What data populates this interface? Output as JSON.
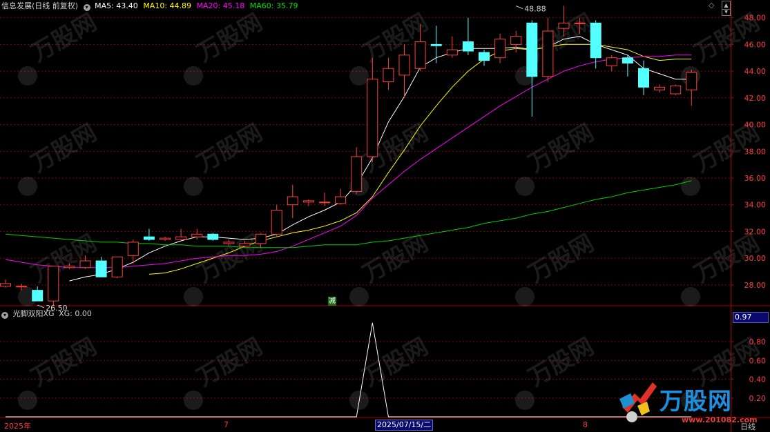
{
  "header": {
    "title": "信息发展(日线 前复权)",
    "ma5_label": "MA5: 43.40",
    "ma10_label": "MA10: 44.89",
    "ma20_label": "MA20: 45.18",
    "ma60_label": "MA60: 35.79"
  },
  "sub": {
    "indicator": "光脚双阳XG",
    "xg_label": "XG: 0.00",
    "value_box": "0.97"
  },
  "bottom": {
    "year_label": "2025年",
    "month7": "7",
    "month8": "8",
    "cursor_date": "2025/07/15/二",
    "period": "日线"
  },
  "reduce_mark": "减",
  "watermark": {
    "brand": "万股网",
    "url": "www.201082.com"
  },
  "colors": {
    "up": "#ff4040",
    "down": "#54ffff",
    "ma5": "#ffffff",
    "ma10": "#ffff00",
    "ma20": "#ff00ff",
    "ma60": "#00d000",
    "grid": "#8b0000",
    "axis": "#b00000",
    "label": "#ff3c3c"
  },
  "chart_data": [
    {
      "type": "candlestick",
      "ylim": [
        26.6,
        48.6
      ],
      "yticks": [
        "48.00",
        "46.00",
        "44.00",
        "42.00",
        "40.00",
        "38.00",
        "36.00",
        "34.00",
        "32.00",
        "30.00",
        "28.00"
      ],
      "annotations": [
        {
          "text": "48.88",
          "bar": 32,
          "price": 48.88
        },
        {
          "text": "26.50",
          "bar": 2,
          "price": 26.5
        }
      ],
      "candles": [
        {
          "o": 27.9,
          "h": 28.4,
          "l": 27.8,
          "c": 28.1
        },
        {
          "o": 27.9,
          "h": 28.1,
          "l": 27.6,
          "c": 27.9
        },
        {
          "o": 27.6,
          "h": 27.9,
          "l": 26.8,
          "c": 26.8
        },
        {
          "o": 26.8,
          "h": 29.4,
          "l": 26.5,
          "c": 29.4
        },
        {
          "o": 29.3,
          "h": 29.6,
          "l": 29.2,
          "c": 29.4
        },
        {
          "o": 29.3,
          "h": 30.2,
          "l": 29.2,
          "c": 29.8
        },
        {
          "o": 29.8,
          "h": 30.1,
          "l": 28.6,
          "c": 28.6
        },
        {
          "o": 28.6,
          "h": 30.1,
          "l": 28.5,
          "c": 30.1
        },
        {
          "o": 30.2,
          "h": 31.4,
          "l": 29.6,
          "c": 31.2
        },
        {
          "o": 31.6,
          "h": 32.2,
          "l": 31.3,
          "c": 31.4
        },
        {
          "o": 31.4,
          "h": 31.6,
          "l": 31.3,
          "c": 31.5
        },
        {
          "o": 31.4,
          "h": 32.2,
          "l": 31.3,
          "c": 31.6
        },
        {
          "o": 31.6,
          "h": 32.2,
          "l": 31.4,
          "c": 31.8
        },
        {
          "o": 31.8,
          "h": 31.9,
          "l": 31.3,
          "c": 31.4
        },
        {
          "o": 31.1,
          "h": 31.4,
          "l": 30.9,
          "c": 31.2
        },
        {
          "o": 30.9,
          "h": 31.3,
          "l": 30.8,
          "c": 31.1
        },
        {
          "o": 31.1,
          "h": 31.9,
          "l": 30.8,
          "c": 31.8
        },
        {
          "o": 31.8,
          "h": 34.0,
          "l": 31.6,
          "c": 33.6
        },
        {
          "o": 34.0,
          "h": 35.5,
          "l": 33.0,
          "c": 34.6
        },
        {
          "o": 34.2,
          "h": 34.4,
          "l": 33.9,
          "c": 34.3
        },
        {
          "o": 34.2,
          "h": 34.9,
          "l": 33.9,
          "c": 34.2
        },
        {
          "o": 34.1,
          "h": 35.2,
          "l": 34.0,
          "c": 34.6
        },
        {
          "o": 35.0,
          "h": 38.3,
          "l": 34.8,
          "c": 37.6
        },
        {
          "o": 37.6,
          "h": 45.0,
          "l": 37.2,
          "c": 43.4
        },
        {
          "o": 43.2,
          "h": 45.0,
          "l": 42.6,
          "c": 44.2
        },
        {
          "o": 43.7,
          "h": 46.0,
          "l": 42.0,
          "c": 45.2
        },
        {
          "o": 44.2,
          "h": 47.5,
          "l": 44.0,
          "c": 46.2
        },
        {
          "o": 46.0,
          "h": 47.4,
          "l": 44.6,
          "c": 45.9
        },
        {
          "o": 45.2,
          "h": 46.6,
          "l": 45.0,
          "c": 45.6
        },
        {
          "o": 46.2,
          "h": 48.0,
          "l": 45.2,
          "c": 45.5
        },
        {
          "o": 45.4,
          "h": 45.6,
          "l": 44.4,
          "c": 44.8
        },
        {
          "o": 45.0,
          "h": 46.8,
          "l": 44.6,
          "c": 46.4
        },
        {
          "o": 46.0,
          "h": 47.0,
          "l": 45.4,
          "c": 46.6
        },
        {
          "o": 47.6,
          "h": 47.8,
          "l": 40.6,
          "c": 43.6
        },
        {
          "o": 43.6,
          "h": 48.0,
          "l": 43.2,
          "c": 47.0
        },
        {
          "o": 47.2,
          "h": 48.9,
          "l": 46.6,
          "c": 47.6
        },
        {
          "o": 47.6,
          "h": 48.0,
          "l": 46.8,
          "c": 47.6
        },
        {
          "o": 47.6,
          "h": 47.8,
          "l": 44.2,
          "c": 45.0
        },
        {
          "o": 44.4,
          "h": 45.2,
          "l": 44.0,
          "c": 45.0
        },
        {
          "o": 45.0,
          "h": 45.2,
          "l": 43.6,
          "c": 44.6
        },
        {
          "o": 44.2,
          "h": 44.8,
          "l": 42.2,
          "c": 42.8
        },
        {
          "o": 42.6,
          "h": 43.0,
          "l": 42.4,
          "c": 42.8
        },
        {
          "o": 42.3,
          "h": 43.0,
          "l": 42.2,
          "c": 42.9
        },
        {
          "o": 42.6,
          "h": 44.1,
          "l": 41.4,
          "c": 43.9
        }
      ],
      "series": [
        {
          "name": "MA5",
          "values": [
            null,
            null,
            null,
            null,
            28.3,
            28.6,
            28.8,
            29.2,
            29.7,
            30.4,
            30.9,
            31.3,
            31.6,
            31.6,
            31.5,
            31.4,
            31.5,
            31.8,
            32.5,
            33.1,
            33.6,
            34.2,
            35.5,
            37.5,
            40.2,
            42.1,
            44.3,
            45.0,
            45.4,
            45.7,
            45.7,
            45.7,
            45.8,
            45.6,
            45.8,
            46.4,
            46.6,
            46.0,
            45.6,
            45.2,
            44.2,
            43.8,
            43.4,
            43.4
          ]
        },
        {
          "name": "MA10",
          "values": [
            null,
            null,
            null,
            null,
            null,
            null,
            null,
            null,
            null,
            28.8,
            28.9,
            29.2,
            29.6,
            30.0,
            30.4,
            30.9,
            31.3,
            31.6,
            31.9,
            32.1,
            32.4,
            32.8,
            33.4,
            34.6,
            36.4,
            38.1,
            39.9,
            41.4,
            42.8,
            44.0,
            44.9,
            45.5,
            45.7,
            45.6,
            45.8,
            46.0,
            46.0,
            46.0,
            45.8,
            45.6,
            45.1,
            44.8,
            44.9,
            44.9
          ]
        },
        {
          "name": "MA20",
          "values": [
            29.9,
            29.7,
            29.5,
            29.4,
            29.3,
            29.3,
            29.3,
            29.3,
            29.4,
            29.5,
            29.6,
            29.8,
            30.0,
            30.1,
            30.2,
            30.2,
            30.3,
            30.5,
            30.9,
            31.4,
            31.9,
            32.4,
            33.2,
            34.5,
            35.5,
            36.5,
            37.4,
            38.2,
            39.0,
            39.8,
            40.6,
            41.4,
            42.1,
            42.8,
            43.4,
            44.0,
            44.4,
            44.7,
            44.9,
            45.0,
            45.1,
            45.1,
            45.2,
            45.2
          ]
        },
        {
          "name": "MA60",
          "values": [
            31.8,
            31.7,
            31.6,
            31.5,
            31.4,
            31.3,
            31.2,
            31.2,
            31.1,
            31.1,
            31.0,
            31.0,
            30.9,
            30.9,
            30.9,
            30.8,
            30.8,
            30.8,
            30.8,
            30.9,
            31.0,
            31.0,
            31.0,
            31.2,
            31.3,
            31.5,
            31.7,
            31.9,
            32.1,
            32.3,
            32.6,
            32.8,
            33.0,
            33.3,
            33.5,
            33.8,
            34.1,
            34.4,
            34.6,
            34.9,
            35.1,
            35.3,
            35.5,
            35.8
          ]
        }
      ]
    },
    {
      "type": "line",
      "ylim": [
        0,
        1.05
      ],
      "yticks": [
        "0.80",
        "0.60",
        "0.40",
        "0.20"
      ],
      "series": [
        {
          "name": "XG",
          "values": [
            0,
            0,
            0,
            0,
            0,
            0,
            0,
            0,
            0,
            0,
            0,
            0,
            0,
            0,
            0,
            0,
            0,
            0,
            0,
            0,
            0,
            0,
            0,
            1,
            0,
            0,
            0,
            0,
            0,
            0,
            0,
            0,
            0,
            0,
            0,
            0,
            0,
            0,
            0,
            0,
            0,
            0,
            0,
            0
          ]
        }
      ]
    }
  ]
}
